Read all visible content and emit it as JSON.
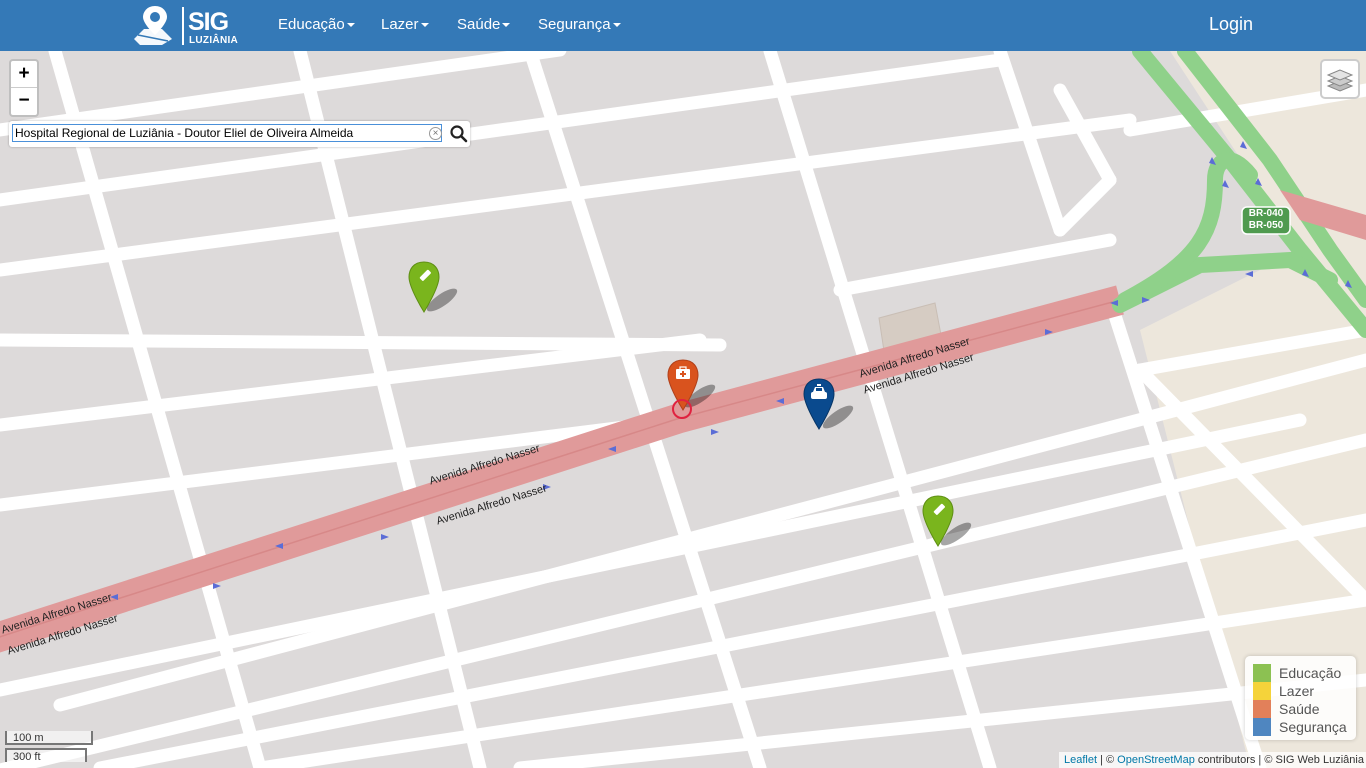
{
  "brand": {
    "name": "SIG",
    "subtitle": "LUZIÂNIA"
  },
  "nav": {
    "items": [
      {
        "label": "Educação"
      },
      {
        "label": "Lazer"
      },
      {
        "label": "Saúde"
      },
      {
        "label": "Segurança"
      }
    ],
    "login": "Login"
  },
  "zoom": {
    "in": "+",
    "out": "−"
  },
  "search": {
    "value": "Hospital Regional de Luziânia - Doutor Eliel de Oliveira Almeida",
    "clear_icon": "clear-x-icon",
    "search_icon": "magnifier-icon"
  },
  "map": {
    "street_labels": [
      "Avenida Alfredo Nasser",
      "Avenida Alfredo Nasser",
      "Avenida Alfredo Nasser",
      "Avenida Alfredo Nasser",
      "Avenida Alfredo Nasser",
      "Avenida Alfredo Nasser"
    ],
    "highway_shield": [
      "BR-040",
      "BR-050"
    ],
    "markers": [
      {
        "category": "Educação",
        "icon": "pencil-icon",
        "color": "#7ab51d"
      },
      {
        "category": "Educação",
        "icon": "pencil-icon",
        "color": "#7ab51d"
      },
      {
        "category": "Saúde",
        "icon": "first-aid-kit-icon",
        "color": "#d9531e"
      },
      {
        "category": "Segurança",
        "icon": "taxi-car-icon",
        "color": "#0a4a8e"
      }
    ]
  },
  "legend": {
    "items": [
      {
        "label": "Educação",
        "color": "#8cc152"
      },
      {
        "label": "Lazer",
        "color": "#f5d33a"
      },
      {
        "label": "Saúde",
        "color": "#e2805a"
      },
      {
        "label": "Segurança",
        "color": "#4f86c0"
      }
    ]
  },
  "scale": {
    "metric": "100 m",
    "imperial": "300 ft"
  },
  "attribution": {
    "leaflet": "Leaflet",
    "sep1": " | © ",
    "osm": "OpenStreetMap",
    "rest": " contributors | © SIG Web Luziânia"
  },
  "colors": {
    "navbar": "#3479b7",
    "land": "#dddada",
    "road": "#ffffff",
    "avenue": "#e09a9a",
    "highway": "#8fd18a"
  }
}
